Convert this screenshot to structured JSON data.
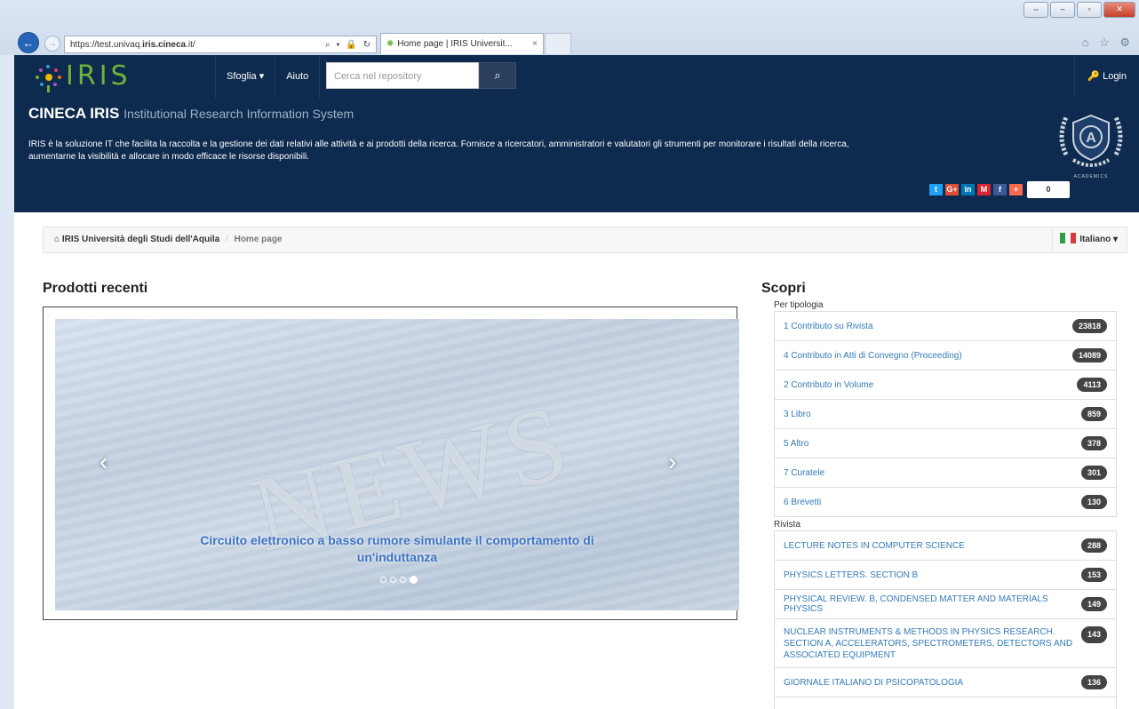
{
  "browser": {
    "url_prefix": "https://test.univaq.",
    "url_host": "iris.cineca",
    "url_suffix": ".it/",
    "url_tools": "⌕ ▾ 🔒 ↻",
    "tab_title": "Home page | IRIS Universit...",
    "tab_close": "×",
    "back": "←",
    "forward": "→",
    "right_icons": "⌂ ☆ ⚙",
    "window_buttons": {
      "restore": "⇔",
      "minimize": "–",
      "maximize": "▫",
      "close": "✕"
    }
  },
  "navbar": {
    "logo": "IRIS",
    "browse": "Sfoglia ▾",
    "help": "Aiuto",
    "search_placeholder": "Cerca nel repository",
    "search_icon": "⌕",
    "login": "Login",
    "login_icon": "🔑"
  },
  "hero": {
    "title": "CINECA IRIS",
    "subtitle": "Institutional Research Information System",
    "description": "IRIS è la soluzione IT che facilita la raccolta e la gestione dei dati relativi alle attività e ai prodotti della ricerca. Fornisce a ricercatori, amministratori e valutatori gli strumenti per monitorare i risultati della ricerca, aumentarne la visibilità e allocare in modo efficace le risorse disponibili.",
    "badge_letter": "A",
    "badge_caption": "ACADEMICS",
    "social": [
      "t",
      "G+",
      "in",
      "M",
      "f",
      "+"
    ],
    "social_colors": [
      "#1da1f2",
      "#dd4b39",
      "#0077b5",
      "#d7262f",
      "#3b5998",
      "#f8694d"
    ],
    "share_count": "0"
  },
  "breadcrumb": {
    "home_icon": "⌂",
    "home": "IRIS Università degli Studi dell'Aquila",
    "separator": "/",
    "current": "Home page",
    "language": "Italiano ▾"
  },
  "recent": {
    "title": "Prodotti recenti",
    "slide_word": "NEWS",
    "caption": "Circuito elettronico a basso rumore simulante il comportamento di un'induttanza",
    "prev": "‹",
    "next": "›",
    "slide_count": 4,
    "active_slide": 4
  },
  "discover": {
    "title": "Scopri",
    "by_type_label": "Per tipologia",
    "by_type": [
      {
        "label": "1 Contributo su Rivista",
        "count": "23818"
      },
      {
        "label": "4 Contributo in Atti di Convegno (Proceeding)",
        "count": "14089"
      },
      {
        "label": "2 Contributo in Volume",
        "count": "4113"
      },
      {
        "label": "3 Libro",
        "count": "859"
      },
      {
        "label": "5 Altro",
        "count": "378"
      },
      {
        "label": "7 Curatele",
        "count": "301"
      },
      {
        "label": "6 Brevetti",
        "count": "130"
      }
    ],
    "journal_label": "Rivista",
    "journals": [
      {
        "label": "LECTURE NOTES IN COMPUTER SCIENCE",
        "count": "288"
      },
      {
        "label": "PHYSICS LETTERS. SECTION B",
        "count": "153"
      },
      {
        "label": "PHYSICAL REVIEW. B, CONDENSED MATTER AND MATERIALS PHYSICS",
        "count": "149"
      },
      {
        "label": "NUCLEAR INSTRUMENTS & METHODS IN PHYSICS RESEARCH. SECTION A, ACCELERATORS, SPECTROMETERS, DETECTORS AND ASSOCIATED EQUIPMENT",
        "count": "143"
      },
      {
        "label": "GIORNALE ITALIANO DI PSICOPATOLOGIA",
        "count": "136"
      }
    ]
  }
}
